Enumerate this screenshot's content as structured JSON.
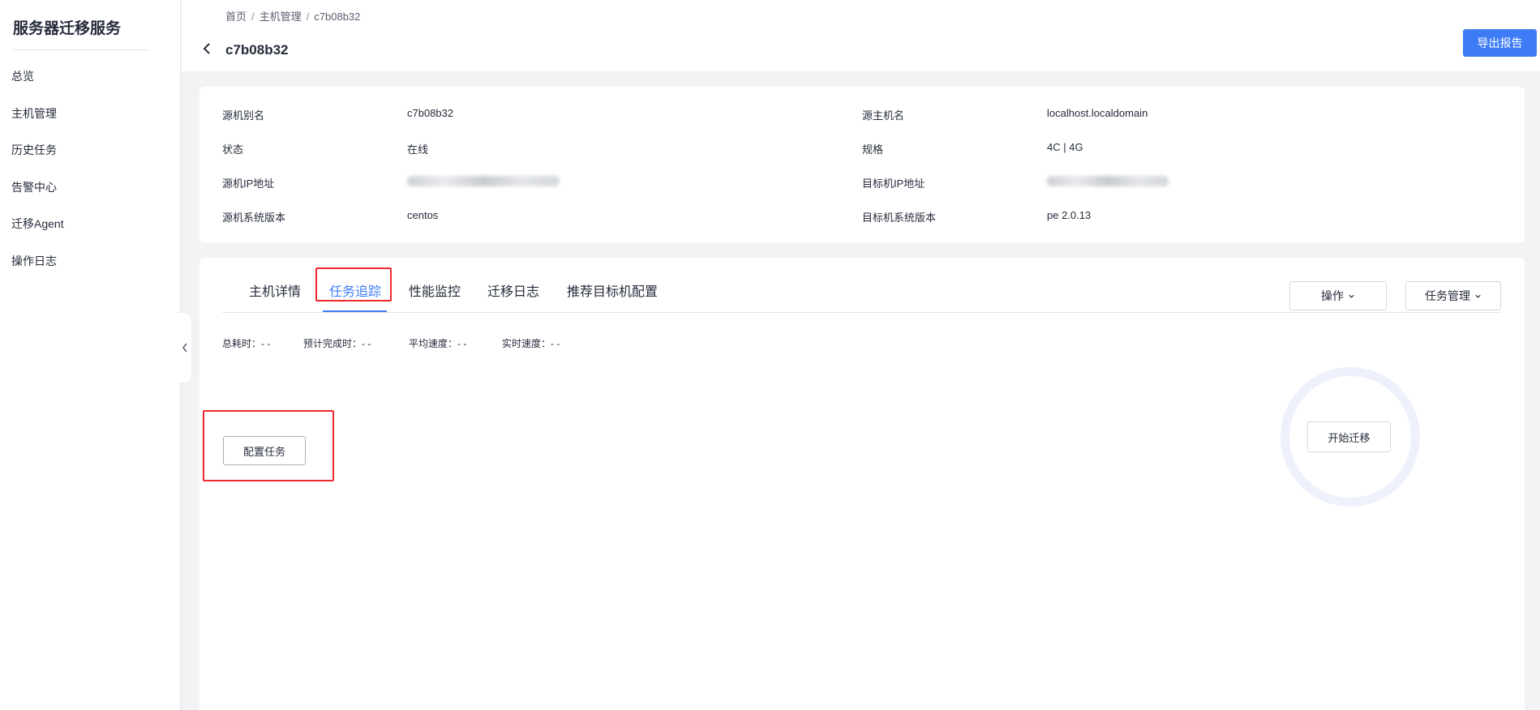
{
  "sidebar": {
    "title": "服务器迁移服务",
    "items": [
      {
        "label": "总览"
      },
      {
        "label": "主机管理"
      },
      {
        "label": "历史任务"
      },
      {
        "label": "告警中心"
      },
      {
        "label": "迁移Agent"
      },
      {
        "label": "操作日志"
      }
    ]
  },
  "header": {
    "breadcrumb": [
      "首页",
      "主机管理",
      "c7b08b32"
    ],
    "breadcrumb_separator": "/",
    "title": "c7b08b32",
    "export_label": "导出报告"
  },
  "info": {
    "left": [
      {
        "label": "源机别名",
        "value": "c7b08b32"
      },
      {
        "label": "状态",
        "value": "在线"
      },
      {
        "label": "源机IP地址",
        "value": "",
        "blurred": true
      },
      {
        "label": "源机系统版本",
        "value": "centos"
      }
    ],
    "right": [
      {
        "label": "源主机名",
        "value": "localhost.localdomain"
      },
      {
        "label": "规格",
        "value": "4C | 4G"
      },
      {
        "label": "目标机IP地址",
        "value": "",
        "blurred": true
      },
      {
        "label": "目标机系统版本",
        "value": "pe 2.0.13"
      }
    ]
  },
  "tabs": {
    "items": [
      {
        "label": "主机详情"
      },
      {
        "label": "任务追踪",
        "active": true
      },
      {
        "label": "性能监控"
      },
      {
        "label": "迁移日志"
      },
      {
        "label": "推荐目标机配置"
      }
    ],
    "operation_label": "操作",
    "task_manage_label": "任务管理"
  },
  "tracking": {
    "stats": [
      {
        "label": "总耗时：",
        "value": "- -"
      },
      {
        "label": "预计完成时：",
        "value": "- -"
      },
      {
        "label": "平均速度：",
        "value": "- -"
      },
      {
        "label": "实时速度：",
        "value": "- -"
      }
    ],
    "configure_label": "配置任务",
    "start_label": "开始迁移"
  },
  "colors": {
    "accent": "#3e7cf5",
    "highlight_box": "#f0292e",
    "ring": "#eef1fb"
  }
}
